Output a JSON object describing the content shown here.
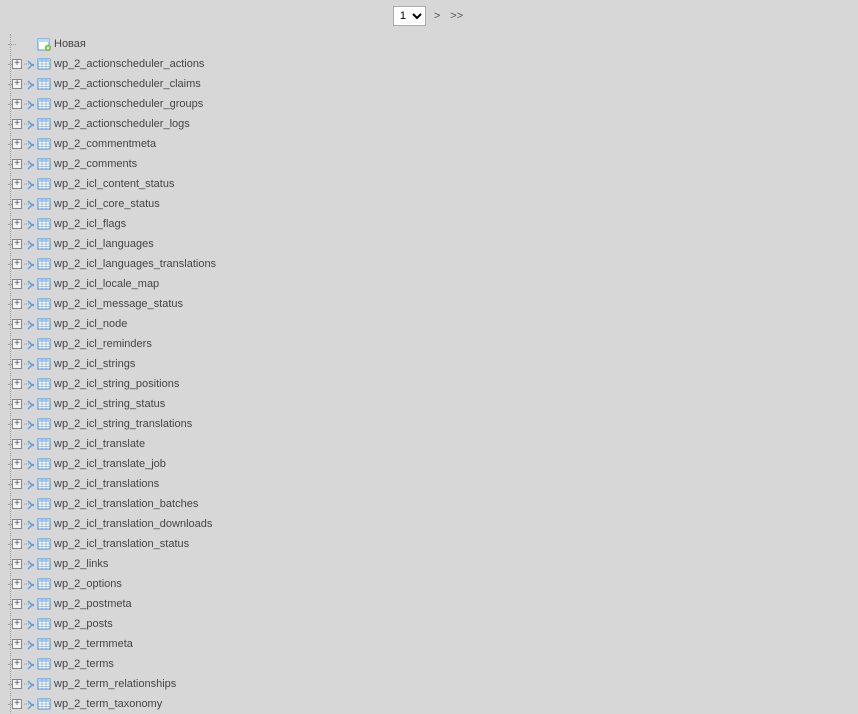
{
  "pager": {
    "selected": "1",
    "options": [
      "1"
    ],
    "next_label": ">",
    "last_label": ">>"
  },
  "tree": {
    "new_label": "Новая",
    "tables": [
      "wp_2_actionscheduler_actions",
      "wp_2_actionscheduler_claims",
      "wp_2_actionscheduler_groups",
      "wp_2_actionscheduler_logs",
      "wp_2_commentmeta",
      "wp_2_comments",
      "wp_2_icl_content_status",
      "wp_2_icl_core_status",
      "wp_2_icl_flags",
      "wp_2_icl_languages",
      "wp_2_icl_languages_translations",
      "wp_2_icl_locale_map",
      "wp_2_icl_message_status",
      "wp_2_icl_node",
      "wp_2_icl_reminders",
      "wp_2_icl_strings",
      "wp_2_icl_string_positions",
      "wp_2_icl_string_status",
      "wp_2_icl_string_translations",
      "wp_2_icl_translate",
      "wp_2_icl_translate_job",
      "wp_2_icl_translations",
      "wp_2_icl_translation_batches",
      "wp_2_icl_translation_downloads",
      "wp_2_icl_translation_status",
      "wp_2_links",
      "wp_2_options",
      "wp_2_postmeta",
      "wp_2_posts",
      "wp_2_termmeta",
      "wp_2_terms",
      "wp_2_term_relationships",
      "wp_2_term_taxonomy"
    ]
  }
}
